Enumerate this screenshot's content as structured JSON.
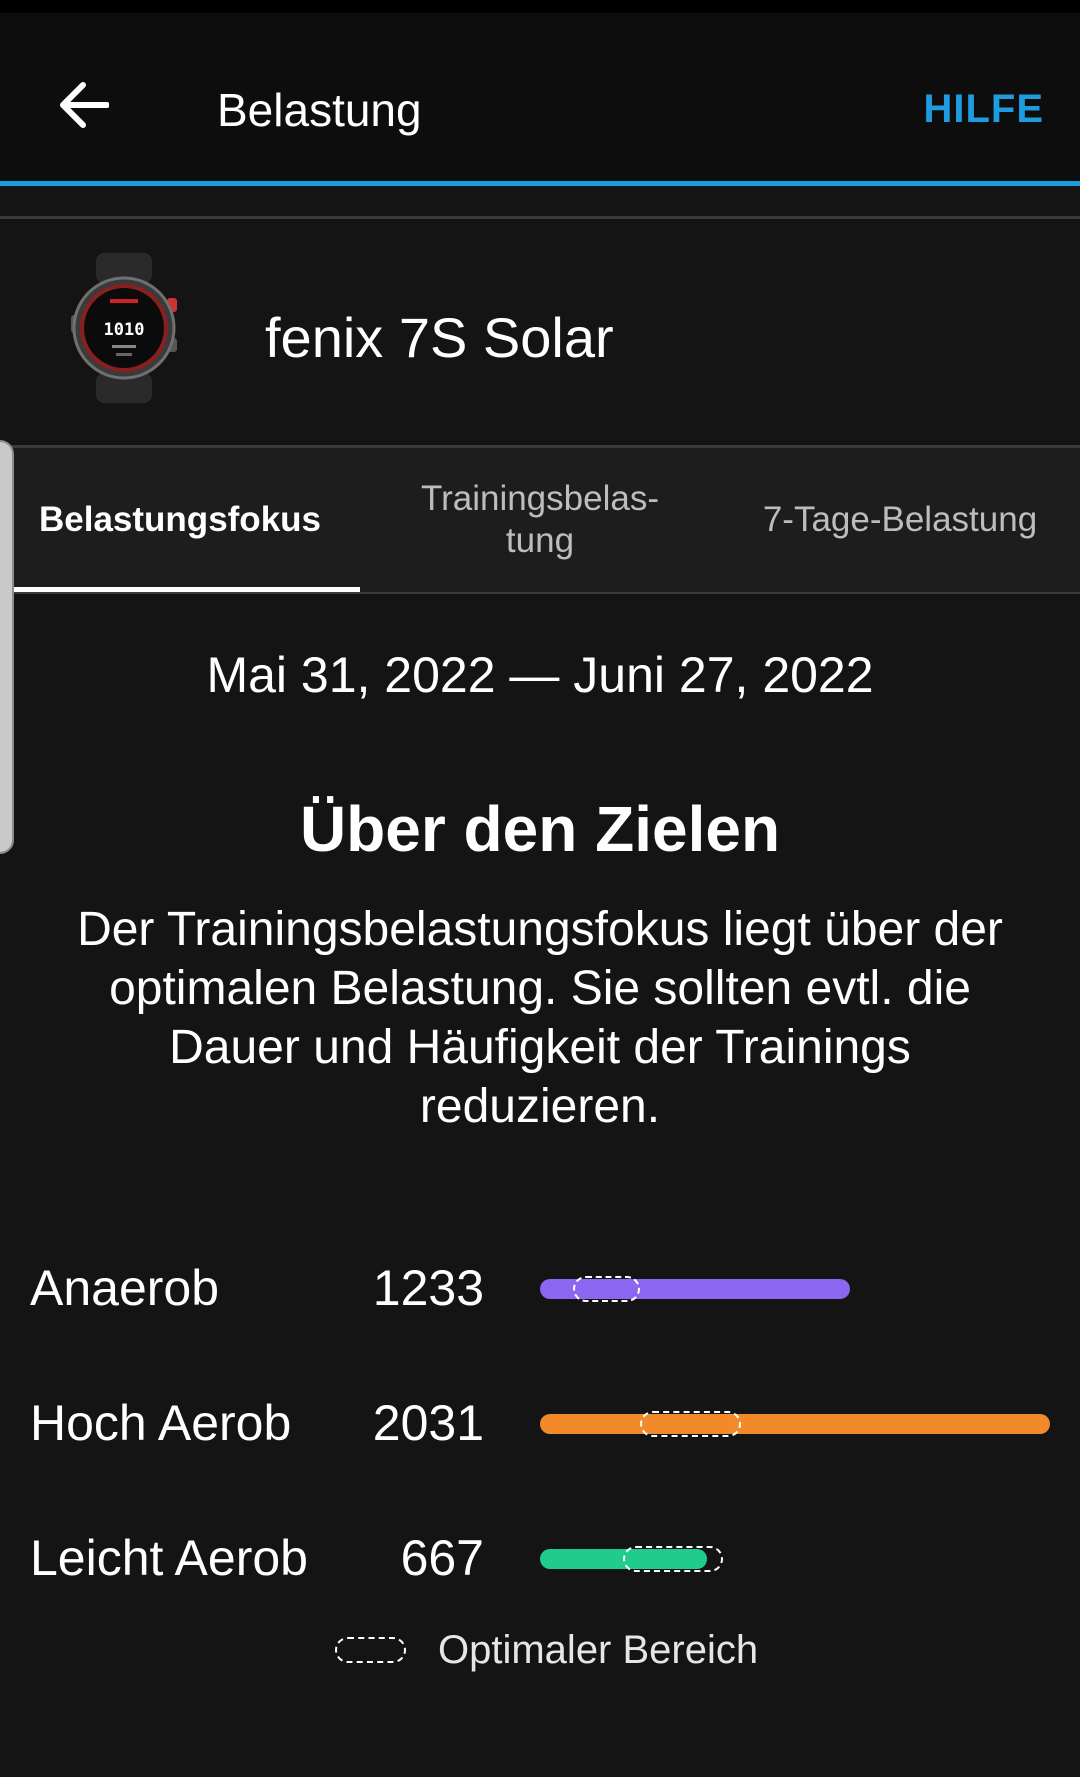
{
  "appbar": {
    "title": "Belastung",
    "help_label": "HILFE",
    "back_icon": "arrow-left-icon"
  },
  "device": {
    "name": "fenix 7S Solar",
    "watch_face_time": "1010"
  },
  "tabs": [
    {
      "label": "Belastungsfokus",
      "active": true
    },
    {
      "label": "Trainingsbelas-\ntung",
      "active": false
    },
    {
      "label": "7-Tage-Belastung",
      "active": false
    }
  ],
  "main": {
    "date_range": "Mai 31, 2022 — Juni 27, 2022",
    "status_heading": "Über den Zielen",
    "status_description": "Der Trainingsbelastungsfokus liegt über der optimalen Belastung. Sie sollten evtl. die Dauer und Häufigkeit der Trainings reduzieren."
  },
  "chart_data": {
    "type": "bar",
    "categories": [
      "Anaerob",
      "Hoch Aerob",
      "Leicht Aerob"
    ],
    "values": [
      1233,
      2031,
      667
    ],
    "colors": [
      "#8b66f0",
      "#f28a2b",
      "#1fcc8c"
    ],
    "optimal_ranges": [
      [
        130,
        400
      ],
      [
        400,
        800
      ],
      [
        330,
        730
      ]
    ],
    "xlim": [
      0,
      2031
    ]
  },
  "legend": {
    "label": "Optimaler Bereich"
  },
  "colors": {
    "accent": "#1a9be0",
    "help": "#1f9be0",
    "background": "#141414"
  }
}
